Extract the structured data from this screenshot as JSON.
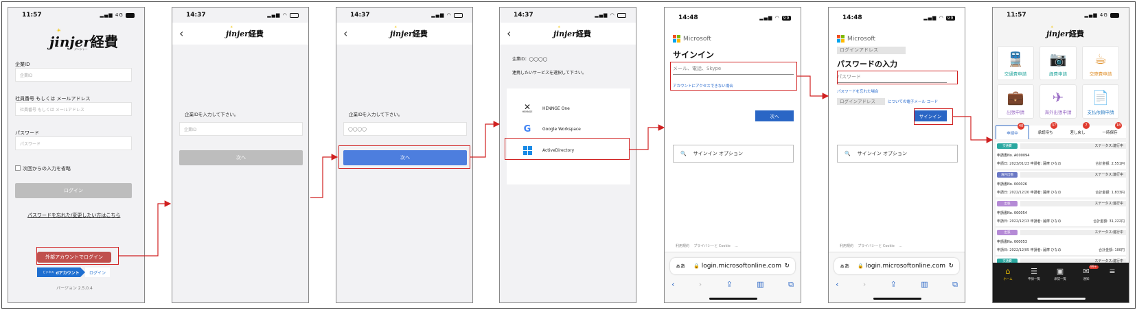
{
  "colors": {
    "accent_red": "#d02020",
    "jinjer_red": "#c0504d",
    "blue": "#2a66c5",
    "login_blue": "#4d7ede",
    "yellow": "#f3c400"
  },
  "s1": {
    "time": "11:57",
    "network": "4G",
    "logo": "jinjer",
    "logo_kanji": "経費",
    "logo_sub": "ジンジャー",
    "company_id_label": "企業ID",
    "company_id_placeholder": "企業ID",
    "employee_label": "社員番号 もしくは メールアドレス",
    "employee_placeholder": "社員番号 もしくは メールアドレス",
    "password_label": "パスワード",
    "password_placeholder": "パスワード",
    "remember_label": "次回からの入力を省略",
    "login_button": "ログイン",
    "forgot_link": "パスワードを忘れた/変更したい方はこちら",
    "external_login_button": "外部アカウントでログイン",
    "d_prefix": "ビジネス",
    "d_account": "dアカウント",
    "d_login": "ログイン",
    "version": "バージョン 2.5.0.4"
  },
  "s2": {
    "time": "14:37",
    "logo": "jinjer",
    "logo_kanji": "経費",
    "prompt": "企業IDを入力して下さい。",
    "placeholder": "企業ID",
    "next_button": "次へ"
  },
  "s3": {
    "time": "14:37",
    "logo": "jinjer",
    "logo_kanji": "経費",
    "prompt": "企業IDを入力して下さい。",
    "value": "◯◯◯◯",
    "next_button": "次へ"
  },
  "s4": {
    "time": "14:37",
    "logo": "jinjer",
    "logo_kanji": "経費",
    "company_line": "企業ID：◯◯◯◯",
    "select_prompt": "連携したいサービスを選択して下さい。",
    "services": [
      {
        "name": "HENNGE One",
        "caption": "HENNGE",
        "icon": "hennge-icon"
      },
      {
        "name": "Google Workspace",
        "caption": "G",
        "icon": "google-icon"
      },
      {
        "name": "ActiveDirectory",
        "caption": "",
        "icon": "windows-icon"
      }
    ]
  },
  "s5": {
    "time": "14:48",
    "battery": "99",
    "brand": "Microsoft",
    "title": "サインイン",
    "email_placeholder": "メール、電話、Skype",
    "cant_access": "アカウントにアクセスできない場合",
    "next_button": "次へ",
    "signin_options": "サインイン オプション",
    "footer": [
      "利用規約",
      "プライバシーと Cookie",
      "..."
    ],
    "url_aa": "ぁあ",
    "url_host": "login.microsoftonline.com"
  },
  "s6": {
    "time": "14:48",
    "battery": "99",
    "brand": "Microsoft",
    "login_address": "ログインアドレス",
    "title": "パスワードの入力",
    "password_placeholder": "パスワード",
    "forgot": "パスワードを忘れた場合",
    "email_code_prefix": "ログインアドレス",
    "email_code": "についての電子メール コード",
    "signin_button": "サインイン",
    "signin_options": "サインイン オプション",
    "footer": [
      "利用規約",
      "プライバシーと Cookie",
      "..."
    ],
    "url_aa": "ぁあ",
    "url_host": "login.microsoftonline.com"
  },
  "s7": {
    "time": "11:57",
    "network": "4G",
    "logo": "jinjer",
    "logo_kanji": "経費",
    "tiles": [
      {
        "label": "交通費申請",
        "icon": "train-icon",
        "glyph": "🚆",
        "color": "#2aa8a0"
      },
      {
        "label": "経費申請",
        "icon": "camera-icon",
        "glyph": "📷",
        "color": "#2aa8a0"
      },
      {
        "label": "交際費申請",
        "icon": "cafe-icon",
        "glyph": "☕",
        "color": "#e0922f"
      },
      {
        "label": "出張申請",
        "icon": "suitcase-icon",
        "glyph": "💼",
        "color": "#9a6cc5"
      },
      {
        "label": "海外出張申請",
        "icon": "plane-icon",
        "glyph": "✈",
        "color": "#9a6cc5"
      },
      {
        "label": "支払依頼申請",
        "icon": "document-icon",
        "glyph": "📄",
        "color": "#3a86c8"
      }
    ],
    "tabs": [
      {
        "label": "申請中",
        "badge": "40"
      },
      {
        "label": "承認待ち",
        "badge": "37"
      },
      {
        "label": "差し戻し",
        "badge": "7"
      },
      {
        "label": "一時保存",
        "badge": "18"
      }
    ],
    "cards": [
      {
        "type": "交通費",
        "type_color": "#2aa8a0",
        "status": "ステータス:進行中",
        "no": "申請書No. A000094",
        "date": "申請日: 2023/01/23",
        "applicant": "申請者: 薩摩 ひなの",
        "amount": "合計金額: 2,551円"
      },
      {
        "type": "海外出張",
        "type_color": "#6a78c5",
        "status": "ステータス:進行中",
        "no": "申請書No. 000026",
        "date": "申請日: 2022/12/20",
        "applicant": "申請者: 薩摩 ひなの",
        "amount": "合計金額: 1,833円"
      },
      {
        "type": "出張",
        "type_color": "#b58ad6",
        "status": "ステータス:進行中",
        "no": "申請書No. 000054",
        "date": "申請日: 2022/12/13",
        "applicant": "申請者: 薩摩 ひなの",
        "amount": "合計金額: 31,222円"
      },
      {
        "type": "出張",
        "type_color": "#b58ad6",
        "status": "ステータス:進行中",
        "no": "申請書No. 000053",
        "date": "申請日: 2022/12/05",
        "applicant": "申請者: 薩摩 ひなの",
        "amount": "合計金額: 100円"
      },
      {
        "type": "交通費",
        "type_color": "#2aa8a0",
        "status": "ステータス:進行中",
        "no": "",
        "date": "",
        "applicant": "",
        "amount": ""
      }
    ],
    "nav": [
      {
        "label": "ホーム",
        "icon": "home-icon",
        "glyph": "⌂"
      },
      {
        "label": "申請一覧",
        "icon": "list-icon",
        "glyph": "☰"
      },
      {
        "label": "承認一覧",
        "icon": "approval-icon",
        "glyph": "▣"
      },
      {
        "label": "通知",
        "icon": "bell-icon",
        "glyph": "✉",
        "badge": "99+"
      },
      {
        "label": "",
        "icon": "menu-icon",
        "glyph": "≡"
      }
    ]
  }
}
